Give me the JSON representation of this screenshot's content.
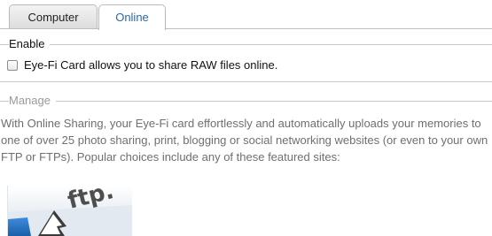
{
  "tabs": [
    {
      "label": "Computer",
      "selected": false
    },
    {
      "label": "Online",
      "selected": true
    }
  ],
  "enable": {
    "heading": "Enable",
    "checkbox_label": "Eye-Fi Card allows you to share RAW files online.",
    "checked": false
  },
  "manage": {
    "heading": "Manage",
    "description": "With Online Sharing, your Eye-Fi card effortlessly and automatically uploads your memories to one of over 25 photo sharing, print, blogging or social networking websites (or even to your own FTP or FTPs). Popular choices include any of these featured sites:",
    "featured_sites": [
      {
        "name": "ftp-logo",
        "text": "ftp."
      }
    ]
  },
  "colors": {
    "active_tab_text": "#2a66b2",
    "manage_heading": "#9a9a9a",
    "description_text": "#6f6f6f",
    "logo_blue": "#1f6fc0"
  }
}
